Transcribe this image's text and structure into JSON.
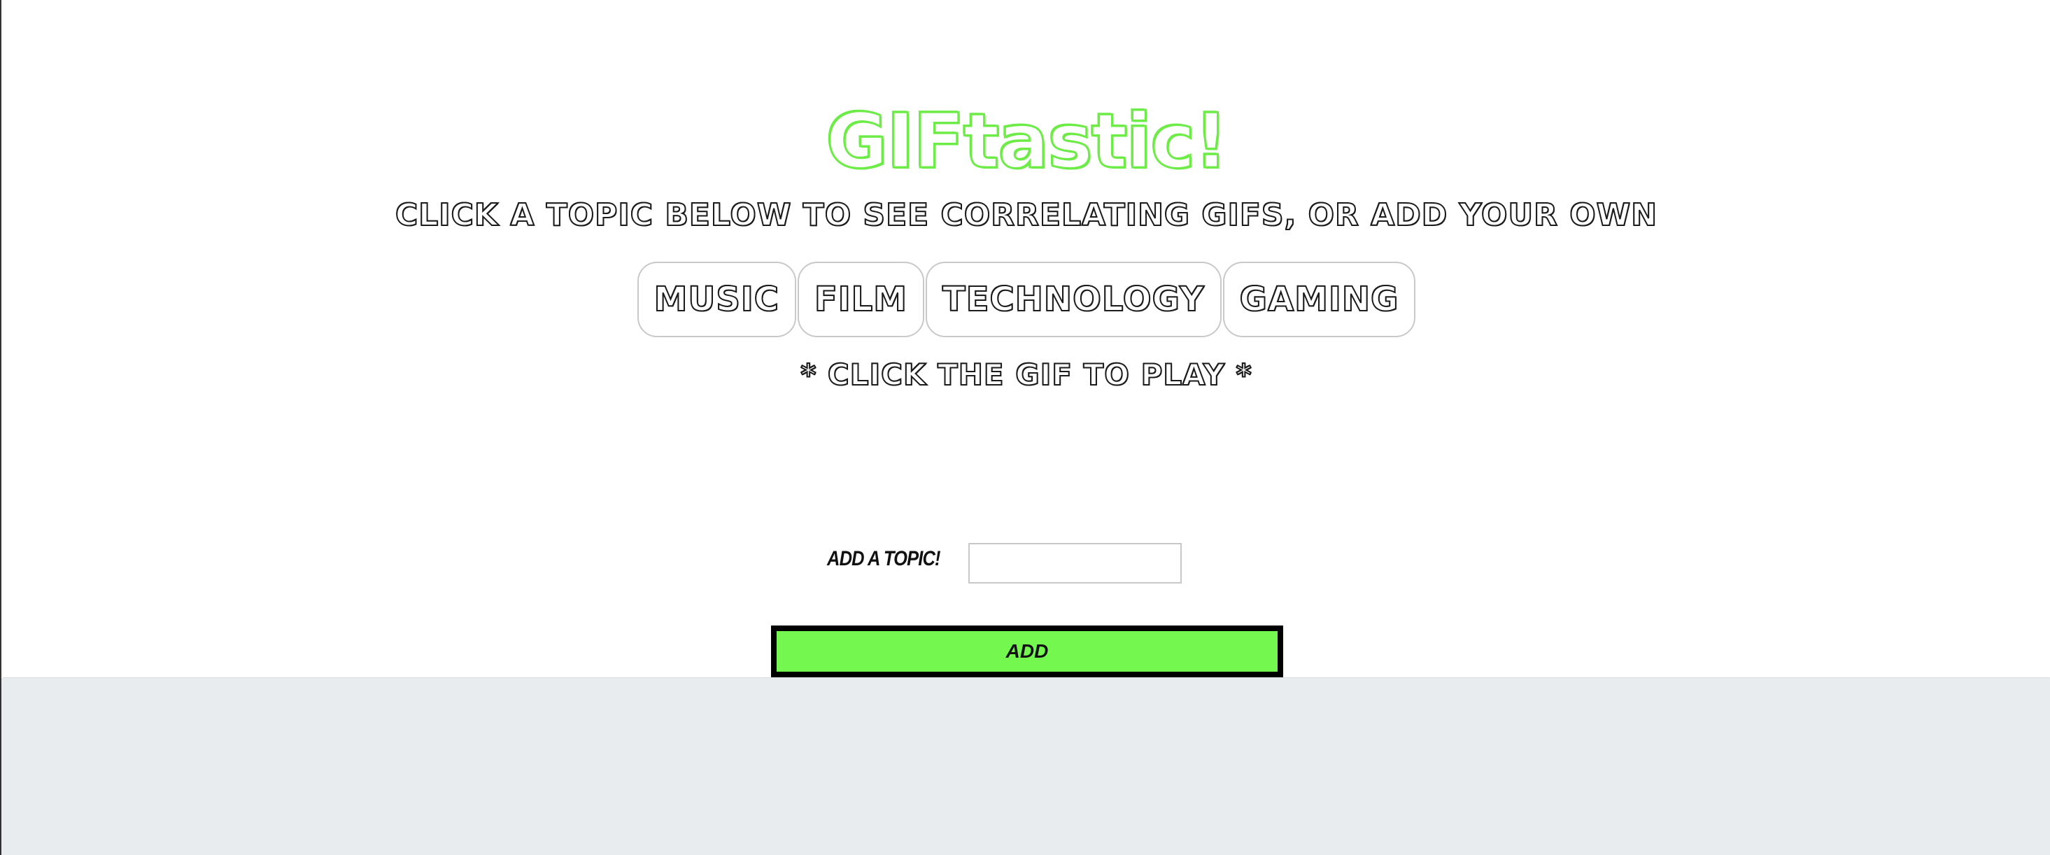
{
  "header": {
    "title": "GIFtastic!",
    "subtitle": "Click a topic below to see correlating GIFs, or add your own"
  },
  "topics": [
    {
      "label": "Music"
    },
    {
      "label": "Film"
    },
    {
      "label": "Technology"
    },
    {
      "label": "Gaming"
    }
  ],
  "hint": "* Click the GIF to play *",
  "form": {
    "label": "Add a topic!",
    "input_value": "",
    "button_label": "Add"
  },
  "colors": {
    "accent": "#6dec47",
    "button_bg": "#74f84f",
    "footer_bg": "#e8ecee"
  }
}
